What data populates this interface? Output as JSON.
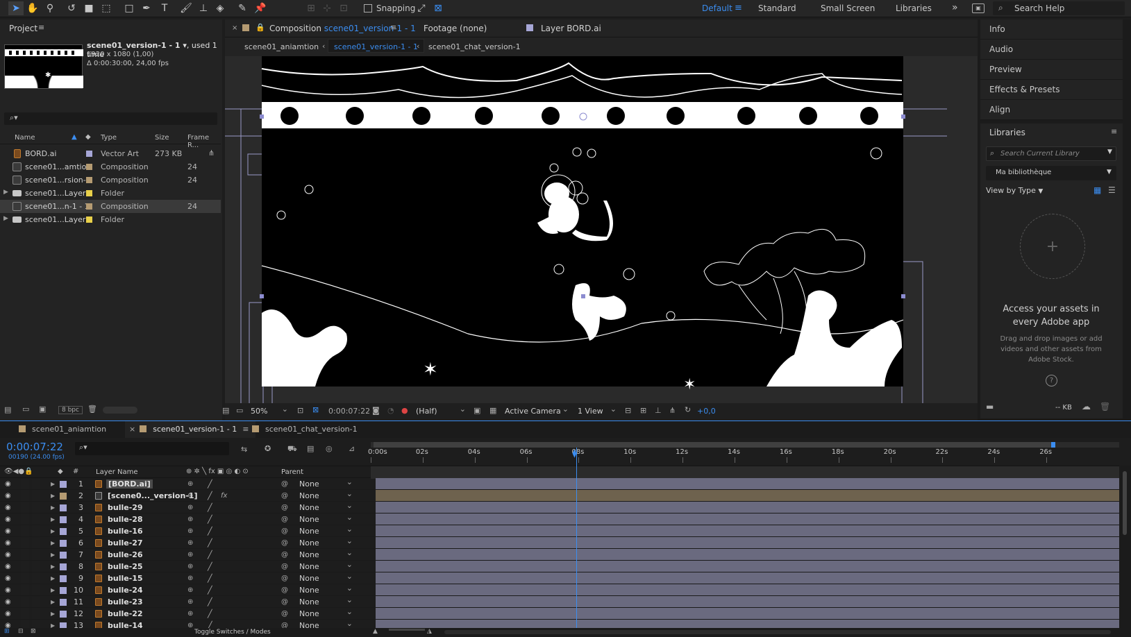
{
  "toolbar": {
    "snapping": "Snapping",
    "workspaces": [
      "Default",
      "Standard",
      "Small Screen",
      "Libraries"
    ],
    "search_placeholder": "Search Help"
  },
  "project": {
    "title": "Project",
    "comp_name": "scene01_version-1 - 1",
    "used": ", used 1 time",
    "resolution": "1920 x 1080 (1,00)",
    "duration": "Δ 0:00:30:00, 24,00 fps",
    "columns": {
      "name": "Name",
      "type": "Type",
      "size": "Size",
      "frame": "Frame R..."
    },
    "items": [
      {
        "name": "BORD.ai",
        "type": "Vector Art",
        "size": "273 KB",
        "frame": "",
        "swatch": "#a6a6d6",
        "kind": "ai"
      },
      {
        "name": "scene01...amtion",
        "type": "Composition",
        "size": "",
        "frame": "24",
        "swatch": "#b59b72",
        "kind": "comp"
      },
      {
        "name": "scene01...rsion-1",
        "type": "Composition",
        "size": "",
        "frame": "24",
        "swatch": "#b59b72",
        "kind": "comp"
      },
      {
        "name": "scene01...Layers",
        "type": "Folder",
        "size": "",
        "frame": "",
        "swatch": "#e8d04a",
        "kind": "folder"
      },
      {
        "name": "scene01...n-1 - 1",
        "type": "Composition",
        "size": "",
        "frame": "24",
        "swatch": "#b59b72",
        "kind": "comp"
      },
      {
        "name": "scene01...Layers",
        "type": "Folder",
        "size": "",
        "frame": "",
        "swatch": "#e8d04a",
        "kind": "folder"
      }
    ],
    "bpc": "8 bpc"
  },
  "viewer": {
    "tab_prefix": "Composition",
    "tab_comp": "scene01_version-1 - 1",
    "footage_tab": "Footage (none)",
    "layer_tab": "Layer BORD.ai",
    "breadcrumbs": [
      "scene01_aniamtion",
      "scene01_version-1 - 1",
      "scene01_chat_version-1"
    ],
    "zoom": "50%",
    "timecode": "0:00:07:22",
    "resolution": "(Half)",
    "camera": "Active Camera",
    "views": "1 View",
    "exposure": "+0,0"
  },
  "right_panel": {
    "items": [
      "Info",
      "Audio",
      "Preview",
      "Effects & Presets",
      "Align"
    ],
    "libraries_title": "Libraries",
    "search_placeholder": "Search Current Library",
    "library_name": "Ma bibliothèque",
    "view_by": "View by Type",
    "access_title": "Access your assets in every Adobe app",
    "access_desc": "Drag and drop images or add videos and other assets from Adobe Stock.",
    "kb": "-- KB"
  },
  "timeline": {
    "tabs": [
      "scene01_aniamtion",
      "scene01_version-1 - 1",
      "scene01_chat_version-1"
    ],
    "timecode": "0:00:07:22",
    "frames": "00190 (24.00 fps)",
    "col_layer_name": "Layer Name",
    "col_parent": "Parent",
    "toggle": "Toggle Switches / Modes",
    "ruler": [
      "0:00s",
      "02s",
      "04s",
      "06s",
      "08s",
      "10s",
      "12s",
      "14s",
      "16s",
      "18s",
      "20s",
      "22s",
      "24s",
      "26s"
    ],
    "playhead_s": 7.92,
    "duration_s": 30,
    "layers": [
      {
        "num": "1",
        "name": "[BORD.ai]",
        "parent": "None",
        "fx": "",
        "type": "ai"
      },
      {
        "num": "2",
        "name": "[scene0..._version-1]",
        "parent": "None",
        "fx": "fx",
        "type": "comp"
      },
      {
        "num": "3",
        "name": "bulle-29",
        "parent": "None",
        "fx": "",
        "type": "ai"
      },
      {
        "num": "4",
        "name": "bulle-28",
        "parent": "None",
        "fx": "",
        "type": "ai"
      },
      {
        "num": "5",
        "name": "bulle-16",
        "parent": "None",
        "fx": "",
        "type": "ai"
      },
      {
        "num": "6",
        "name": "bulle-27",
        "parent": "None",
        "fx": "",
        "type": "ai"
      },
      {
        "num": "7",
        "name": "bulle-26",
        "parent": "None",
        "fx": "",
        "type": "ai"
      },
      {
        "num": "8",
        "name": "bulle-25",
        "parent": "None",
        "fx": "",
        "type": "ai"
      },
      {
        "num": "9",
        "name": "bulle-15",
        "parent": "None",
        "fx": "",
        "type": "ai"
      },
      {
        "num": "10",
        "name": "bulle-24",
        "parent": "None",
        "fx": "",
        "type": "ai"
      },
      {
        "num": "11",
        "name": "bulle-23",
        "parent": "None",
        "fx": "",
        "type": "ai"
      },
      {
        "num": "12",
        "name": "bulle-22",
        "parent": "None",
        "fx": "",
        "type": "ai"
      },
      {
        "num": "13",
        "name": "bulle-14",
        "parent": "None",
        "fx": "",
        "type": "ai"
      }
    ]
  }
}
